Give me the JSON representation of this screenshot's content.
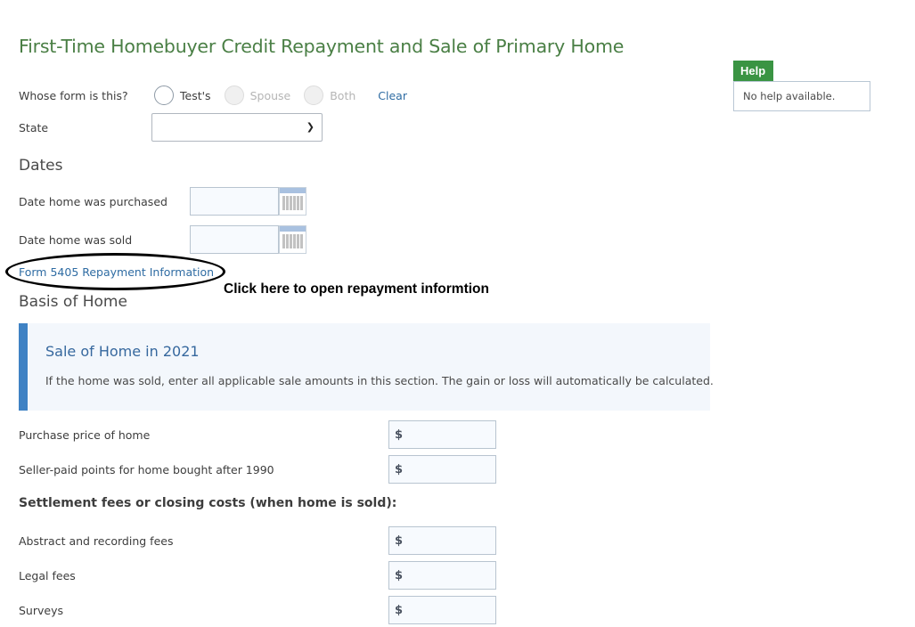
{
  "page": {
    "title": "First-Time Homebuyer Credit Repayment and Sale of Primary Home"
  },
  "whose_form": {
    "label": "Whose form is this?",
    "options": [
      {
        "label": "Test's",
        "enabled": true,
        "selected": false
      },
      {
        "label": "Spouse",
        "enabled": false,
        "selected": false
      },
      {
        "label": "Both",
        "enabled": false,
        "selected": false
      }
    ],
    "clear_label": "Clear"
  },
  "state": {
    "label": "State",
    "selected_value": "",
    "icon": "chevron-down-icon"
  },
  "dates": {
    "heading": "Dates",
    "fields": [
      {
        "label": "Date home was purchased",
        "value": "",
        "icon": "calendar-icon"
      },
      {
        "label": "Date home was sold",
        "value": "",
        "icon": "calendar-icon"
      }
    ]
  },
  "repayment_link": {
    "label": "Form 5405 Repayment Information"
  },
  "annotation": {
    "text": "Click here to open repayment informtion"
  },
  "basis": {
    "heading": "Basis of Home",
    "info_box": {
      "title": "Sale of Home in 2021",
      "text": "If the home was sold, enter all applicable sale amounts in this section. The gain or loss will automatically be calculated."
    },
    "fields": [
      {
        "label": "Purchase price of home",
        "currency": "$",
        "value": ""
      },
      {
        "label": "Seller-paid points for home bought after 1990",
        "currency": "$",
        "value": ""
      }
    ],
    "settlement_heading": "Settlement fees or closing costs (when home is sold):",
    "settlement_fields": [
      {
        "label": "Abstract and recording fees",
        "currency": "$",
        "value": ""
      },
      {
        "label": "Legal fees",
        "currency": "$",
        "value": ""
      },
      {
        "label": "Surveys",
        "currency": "$",
        "value": ""
      }
    ]
  },
  "help": {
    "tab_label": "Help",
    "text": "No help available."
  },
  "colors": {
    "title_green": "#4a7f45",
    "help_green": "#3a9443",
    "link_blue": "#2f6ca3",
    "info_accent": "#3f82c4"
  }
}
